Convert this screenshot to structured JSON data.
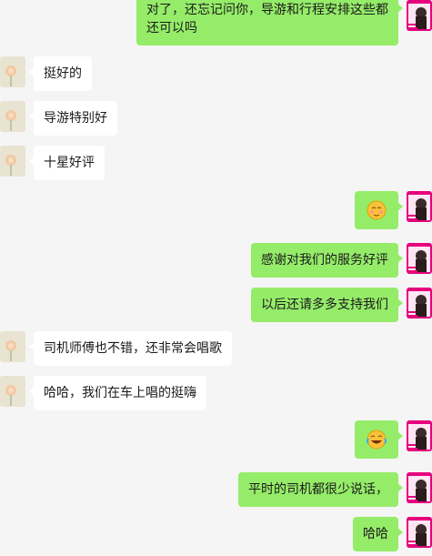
{
  "colors": {
    "background": "#f5f5f5",
    "incoming_bubble": "#ffffff",
    "outgoing_bubble": "#95ec69",
    "outgoing_avatar_accent": "#e6007e"
  },
  "messages": [
    {
      "side": "right",
      "type": "text",
      "text": "对了，还忘记问你，导游和行程安排这些都还可以吗"
    },
    {
      "side": "left",
      "type": "text",
      "text": "挺好的"
    },
    {
      "side": "left",
      "type": "text",
      "text": "导游特别好"
    },
    {
      "side": "left",
      "type": "text",
      "text": "十星好评"
    },
    {
      "side": "right",
      "type": "emoji",
      "icon": "shy-face-emoji"
    },
    {
      "side": "right",
      "type": "text",
      "text": "感谢对我们的服务好评"
    },
    {
      "side": "right",
      "type": "text",
      "text": "以后还请多多支持我们"
    },
    {
      "side": "left",
      "type": "text",
      "text": "司机师傅也不错，还非常会唱歌"
    },
    {
      "side": "left",
      "type": "text",
      "text": "哈哈，我们在车上唱的挺嗨"
    },
    {
      "side": "right",
      "type": "emoji",
      "icon": "laughing-tears-emoji"
    },
    {
      "side": "right",
      "type": "text",
      "text": "平时的司机都很少说话，"
    },
    {
      "side": "right",
      "type": "text",
      "text": "哈哈"
    }
  ]
}
